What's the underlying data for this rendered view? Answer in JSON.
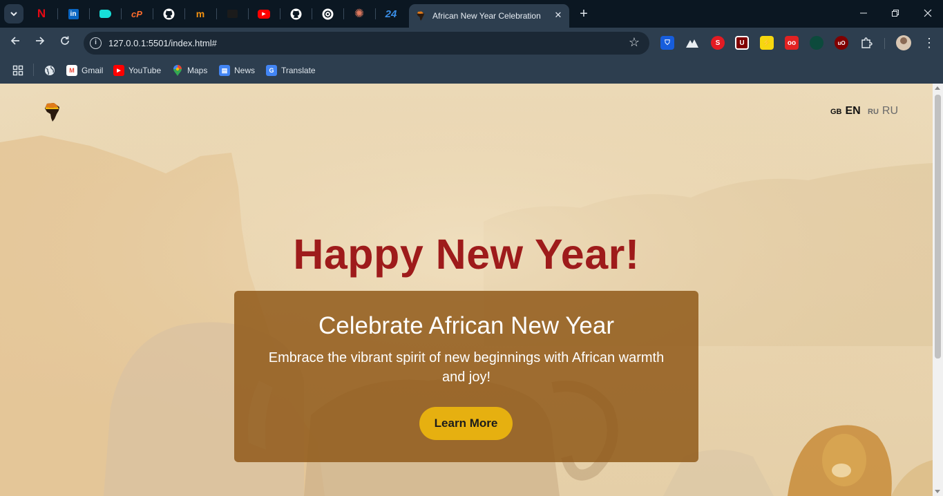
{
  "browser": {
    "active_tab": {
      "title": "African New Year Celebration"
    },
    "pinned_tabs": [
      {
        "icon": "netflix-icon",
        "glyph": "N",
        "color": "#e50914"
      },
      {
        "icon": "linkedin-icon",
        "glyph": "in",
        "color": "#0a66c2"
      },
      {
        "icon": "cyan-tag-icon",
        "glyph": "",
        "color": "#17e0d9"
      },
      {
        "icon": "cpanel-icon",
        "glyph": "cP",
        "color": "#ff6c2c"
      },
      {
        "icon": "github-icon",
        "glyph": "",
        "color": "#ffffff"
      },
      {
        "icon": "flag-icon",
        "glyph": "m",
        "color": "#f29111"
      },
      {
        "icon": "dark-square-icon",
        "glyph": "",
        "color": "#1b1b1b"
      },
      {
        "icon": "youtube-icon",
        "glyph": "▶",
        "color": "#ff0000"
      },
      {
        "icon": "github-icon",
        "glyph": "",
        "color": "#ffffff"
      },
      {
        "icon": "openai-icon",
        "glyph": "",
        "color": "#ffffff"
      },
      {
        "icon": "sunburst-icon",
        "glyph": "✺",
        "color": "#e07a5f"
      },
      {
        "icon": "calendar-24-icon",
        "glyph": "24",
        "color": "#3a8ee6"
      }
    ],
    "address": "127.0.0.1:5501/index.html#",
    "extensions": [
      {
        "icon": "bitwarden-icon",
        "glyph": "⛉",
        "color": "#175ddc"
      },
      {
        "icon": "mountain-icon",
        "glyph": "▲",
        "color": "#2d3e4f"
      },
      {
        "icon": "shield-s-icon",
        "glyph": "S",
        "color": "#e31b23"
      },
      {
        "icon": "ublock-icon",
        "glyph": "U",
        "color": "#800000"
      },
      {
        "icon": "lightning-icon",
        "glyph": "⚡",
        "color": "#f6d70f"
      },
      {
        "icon": "glasses-icon",
        "glyph": "oo",
        "color": "#e22222"
      },
      {
        "icon": "dark-green-icon",
        "glyph": "",
        "color": "#0c4a3c"
      },
      {
        "icon": "ublock-origin-icon",
        "glyph": "uO",
        "color": "#800000"
      }
    ],
    "bookmarks": [
      {
        "label": "Gmail",
        "icon": "gmail-icon",
        "glyph": "M",
        "color": "#ea4335"
      },
      {
        "label": "YouTube",
        "icon": "youtube-icon",
        "glyph": "▶",
        "color": "#ff0000"
      },
      {
        "label": "Maps",
        "icon": "maps-icon",
        "glyph": "⬤",
        "color": "#34a853"
      },
      {
        "label": "News",
        "icon": "news-icon",
        "glyph": "▤",
        "color": "#4285f4"
      },
      {
        "label": "Translate",
        "icon": "translate-icon",
        "glyph": "G",
        "color": "#4285f4"
      }
    ]
  },
  "page": {
    "languages": [
      {
        "flag": "GB",
        "code": "EN",
        "active": true
      },
      {
        "flag": "RU",
        "code": "RU",
        "active": false
      }
    ],
    "hero": {
      "title": "Happy New Year!",
      "subtitle": "Celebrate African New Year",
      "description": "Embrace the vibrant spirit of new beginnings with African warmth and joy!",
      "cta_label": "Learn More"
    },
    "colors": {
      "title": "#9e1b1b",
      "card": "#8f5818",
      "cta": "#e6b010",
      "background": "#ecdbba"
    }
  }
}
